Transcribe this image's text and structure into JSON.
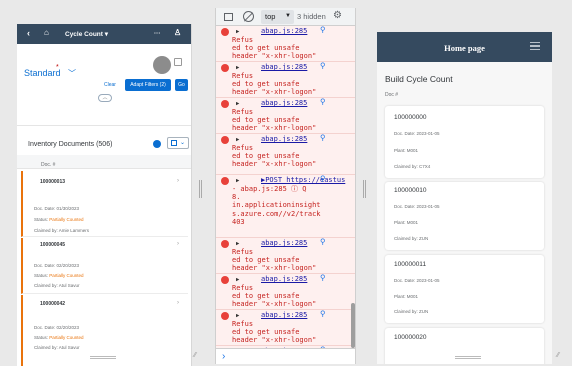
{
  "left_app": {
    "header": {
      "back": "‹",
      "home": "⌂",
      "title": "Cycle Count ▾",
      "more": "···",
      "user": "♙"
    },
    "variant": {
      "name": "Standard",
      "asterisk": "*",
      "chevron": "﹀"
    },
    "filter_bar": {
      "clear": "Clear",
      "adapt": "Adapt Filters (2)",
      "go": "Go",
      "collapse": "︿"
    },
    "table_title": "Inventory Documents (506)",
    "column_header": "Doc. #",
    "rows": [
      {
        "number": "100000013",
        "date": "Doc. Date: 01/30/2023",
        "status_label": "Status: ",
        "status": "Partially Counted",
        "claimed": "Claimed by: Amie Lammers"
      },
      {
        "number": "100000045",
        "date": "Doc. Date: 02/20/2023",
        "status_label": "Status: ",
        "status": "Partially Counted",
        "claimed": "Claimed by: Atul Savur"
      },
      {
        "number": "100000042",
        "date": "Doc. Date: 02/20/2023",
        "status_label": "Status: ",
        "status": "Partially Counted",
        "claimed": "Claimed by: Atul Savur"
      }
    ],
    "colors": {
      "header": "#354a5f",
      "accent": "#0a6ed1",
      "warning": "#e9730c"
    }
  },
  "devtools": {
    "context": "top",
    "context_arrow": "▼",
    "hidden": "3 hidden",
    "gear": "⚙",
    "prompt": "›",
    "messages": [
      {
        "source": "abap.js:285",
        "lines": "Refus\ned to get unsafe\nheader \"x-xhr-logon\""
      },
      {
        "source": "abap.js:285",
        "lines": "Refus\ned to get unsafe\nheader \"x-xhr-logon\""
      },
      {
        "source": "abap.js:285",
        "lines": "Refus\ned to get unsafe\nheader \"x-xhr-logon\""
      },
      {
        "source": "abap.js:285",
        "lines": "Refus\ned to get unsafe\nheader \"x-xhr-logon\""
      },
      {
        "source": "▶POST https://eastus",
        "lines": "- abap.js:285 ⓘ Q\n8.\nin.applicationinsight\ns.azure.com//v2/track\n403"
      },
      {
        "source": "abap.js:285",
        "lines": "Refus\ned to get unsafe\nheader \"x-xhr-logon\""
      },
      {
        "source": "abap.js:285",
        "lines": "Refus\ned to get unsafe\nheader \"x-xhr-logon\""
      },
      {
        "source": "abap.js:285",
        "lines": "Refus\ned to get unsafe\nheader \"x-xhr-logon\""
      },
      {
        "source": "abap.js:285",
        "lines": "Refus\ned to get unsafe\nheader \"x-xhr-logon\""
      }
    ],
    "colors": {
      "error_bg": "#fef0ef",
      "error_text": "#c5221f",
      "link": "#1a1aa6"
    }
  },
  "right_app": {
    "header_title": "Home page",
    "page_title": "Build Cycle Count",
    "doc_label": "Doc #",
    "cards": [
      {
        "number": "100000000",
        "date": "Doc. Date: 2023-01-05",
        "plant": "Plant: M001",
        "claimed": "Claimed by: C7X4"
      },
      {
        "number": "100000010",
        "date": "Doc. Date: 2023-01-05",
        "plant": "Plant: M001",
        "claimed": "Claimed by: ZUN"
      },
      {
        "number": "100000011",
        "date": "Doc. Date: 2023-01-05",
        "plant": "Plant: M001",
        "claimed": "Claimed by: ZUN"
      },
      {
        "number": "100000020"
      }
    ]
  }
}
